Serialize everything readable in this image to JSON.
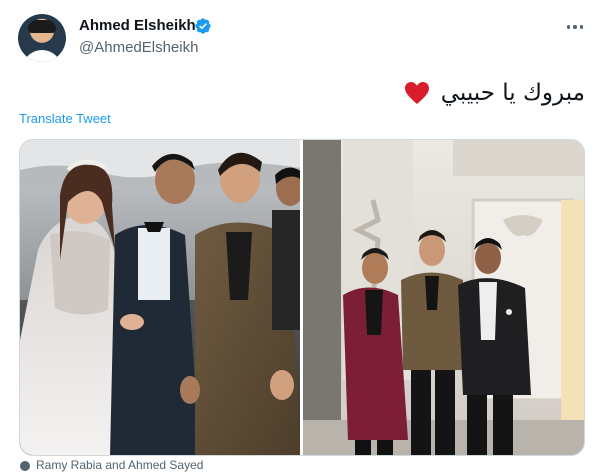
{
  "tweet": {
    "author_name": "Ahmed Elsheikh",
    "author_handle": "@AhmedElsheikh",
    "verified": true,
    "text": "مبروك يا حبيبي",
    "emoji": "heart",
    "translate_label": "Translate Tweet",
    "footer_text": "Ramy Rabia and Ahmed Sayed"
  },
  "icons": {
    "verified": "verified-badge-icon",
    "more": "more-options-icon",
    "heart": "red-heart-emoji"
  },
  "colors": {
    "accent": "#1d9bf0",
    "text_primary": "#0f1419",
    "text_secondary": "#536471",
    "heart": "#d81e2c"
  }
}
